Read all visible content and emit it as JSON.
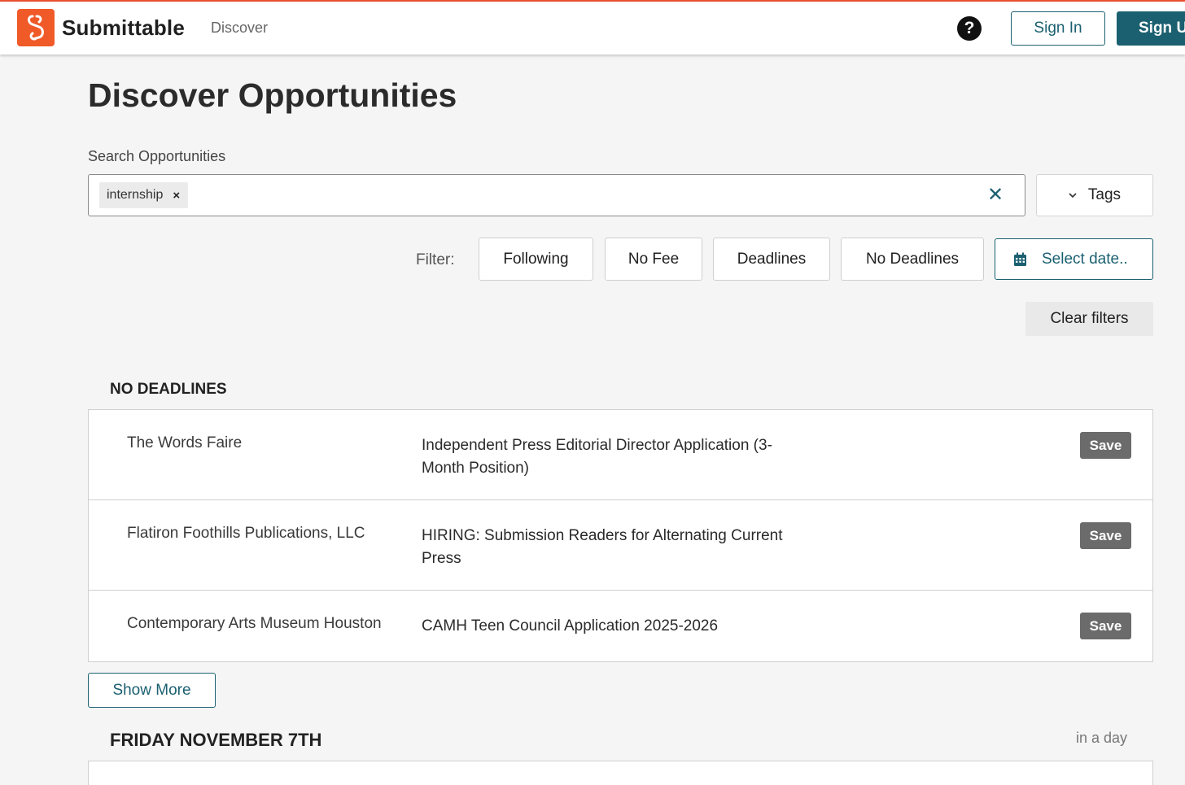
{
  "header": {
    "brand": "Submittable",
    "nav_discover": "Discover",
    "help_glyph": "?",
    "sign_in": "Sign In",
    "sign_up": "Sign Up",
    "logo_icon": "submittable-logo-icon",
    "accent": "#f05a28",
    "primary": "#1b6070"
  },
  "page": {
    "title": "Discover Opportunities"
  },
  "search": {
    "label": "Search Opportunities",
    "chips": [
      {
        "label": "internship",
        "remove_glyph": "×"
      }
    ],
    "value": "",
    "clear_glyph": "✕",
    "tags_label": "Tags",
    "tags_chevron": "⌄"
  },
  "filters": {
    "label": "Filter:",
    "buttons": [
      "Following",
      "No Fee",
      "Deadlines",
      "No Deadlines"
    ],
    "date_label": "Select date..",
    "clear_label": "Clear filters"
  },
  "sections": [
    {
      "heading": "NO DEADLINES",
      "rows": [
        {
          "org": "The Words Faire",
          "title": "Independent Press Editorial Director Application (3-Month Position)",
          "save": "Save"
        },
        {
          "org": "Flatiron Foothills Publications, LLC",
          "title": "HIRING: Submission Readers for Alternating Current Press",
          "save": "Save"
        },
        {
          "org": "Contemporary Arts Museum Houston",
          "title": "CAMH Teen Council Application 2025-2026",
          "save": "Save"
        }
      ],
      "show_more": "Show More"
    },
    {
      "heading_day": "FRIDAY",
      "heading_date": "NOVEMBER 7TH",
      "relative": "in a day"
    }
  ]
}
